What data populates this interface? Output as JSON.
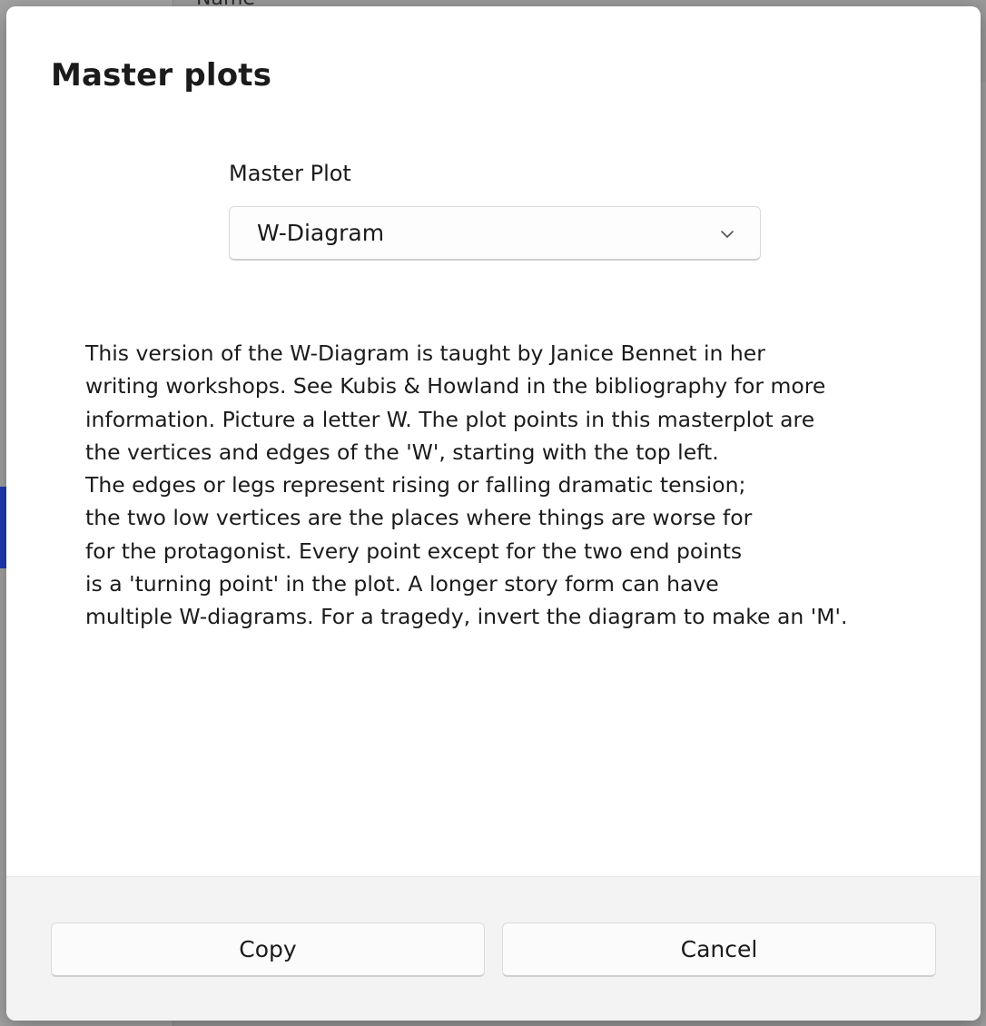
{
  "background": {
    "header_text": "Name"
  },
  "dialog": {
    "title": "Master plots",
    "master_plot": {
      "label": "Master Plot",
      "selected": "W-Diagram"
    },
    "description_lines": [
      "This version of the W-Diagram is taught by Janice Bennet in her",
      "writing workshops. See Kubis & Howland in the bibliography for more",
      "information. Picture a letter W. The plot points in this masterplot are",
      "the vertices and edges of the 'W', starting with the top left.",
      "The edges or legs represent rising or falling dramatic tension;",
      "the two low vertices are the places where things are worse for",
      "for the protagonist. Every point except for the two end points",
      "is a 'turning point' in the plot. A longer story form can have",
      "multiple W-diagrams. For a tragedy, invert the diagram to make an 'M'."
    ],
    "buttons": {
      "copy": "Copy",
      "cancel": "Cancel"
    }
  },
  "icons": {
    "dropdown": "chevron-down-icon"
  },
  "colors": {
    "overlay": "#9a9a9a",
    "dialog_bg": "#ffffff",
    "footer_bg": "#f3f3f3",
    "selected_row": "#1f3bb8",
    "text": "#1b1b1b"
  }
}
